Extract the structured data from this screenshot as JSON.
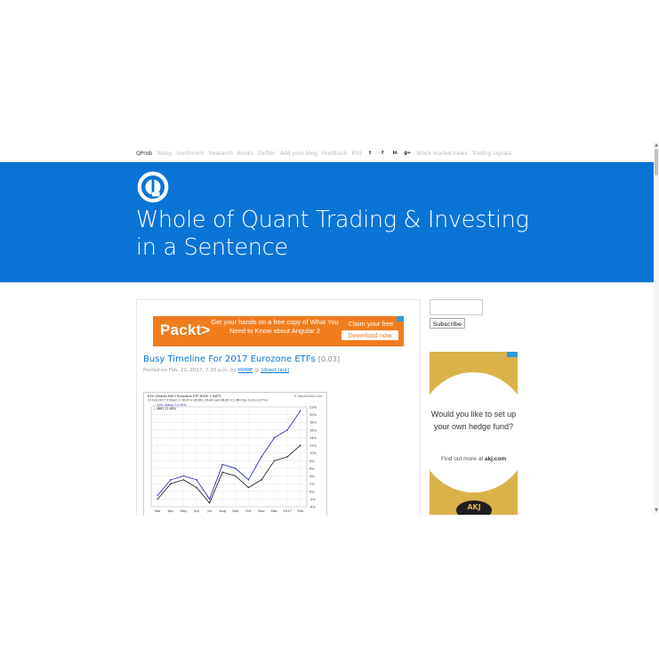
{
  "nav": {
    "brand": "QProb",
    "links": [
      "Today",
      "Sentiment",
      "Research",
      "Books",
      "Defiler",
      "Add your blog",
      "Feedback",
      "RSS"
    ],
    "social": [
      "twitter-icon",
      "facebook-icon",
      "linkedin-icon",
      "google-plus-icon"
    ],
    "social_glyphs": [
      "t",
      "f",
      "in",
      "g+"
    ],
    "extra_links": [
      "Stock market news",
      "Trading signals"
    ]
  },
  "hero": {
    "title": "Whole of Quant Trading & Investing in a Sentence",
    "background": "#0a74d6"
  },
  "ad_banner": {
    "brand": "Packt>",
    "text": "Get your hands on a free copy of What You Need to Know about Angular 2",
    "cta_top": "Claim your free",
    "cta_button": "Download now",
    "color": "#ef7d1e"
  },
  "post": {
    "title": "Busy Timeline For 2017 Eurozone ETFs",
    "score": "[0.03]",
    "meta_prefix": "Posted on Feb. 21, 2017, 7:30 p.m. by",
    "author": "HOME",
    "at": "@",
    "direct_link": "[direct link]"
  },
  "chart_data": {
    "type": "line",
    "title": "EZU iShares MSCI Eurozone ETF  NYSE + BATS",
    "subtitle": "17-Feb-2017 3:00pm   O 36.47  H 36.66  L 36.44  Last 36.60  V 2.0M  Chg -0.10 (-0.27%)",
    "source": "© StockCharts.com",
    "x": [
      "Mar",
      "Apr",
      "May",
      "Jun",
      "Jul",
      "Aug",
      "Sep",
      "Oct",
      "Nov",
      "Dec",
      "2017",
      "Feb"
    ],
    "ylabels": [
      "22%",
      "20%",
      "18%",
      "16%",
      "14%",
      "12%",
      "10%",
      "8%",
      "6%",
      "4%",
      "2%",
      "0%",
      "-2%",
      "-4%"
    ],
    "ylim": [
      -4,
      22
    ],
    "series": [
      {
        "name": "EZU (Daily) 12.95%",
        "values": [
          -1,
          3,
          4,
          3,
          -2,
          7,
          6,
          3,
          9,
          14,
          16,
          21
        ],
        "color": "#1a1aa8"
      },
      {
        "name": "MKO 12.60%",
        "values": [
          -2,
          2,
          3,
          1,
          -3,
          5,
          4,
          1,
          3,
          8,
          9,
          12
        ],
        "color": "#111111"
      }
    ]
  },
  "sidebar": {
    "subscribe_label": "Subscribe"
  },
  "ad2": {
    "question": "Would you like to set up your own hedge fund?",
    "find_out": "Find out more at",
    "site": "akj.com",
    "logo": "AKJ",
    "color": "#d9b24a"
  }
}
